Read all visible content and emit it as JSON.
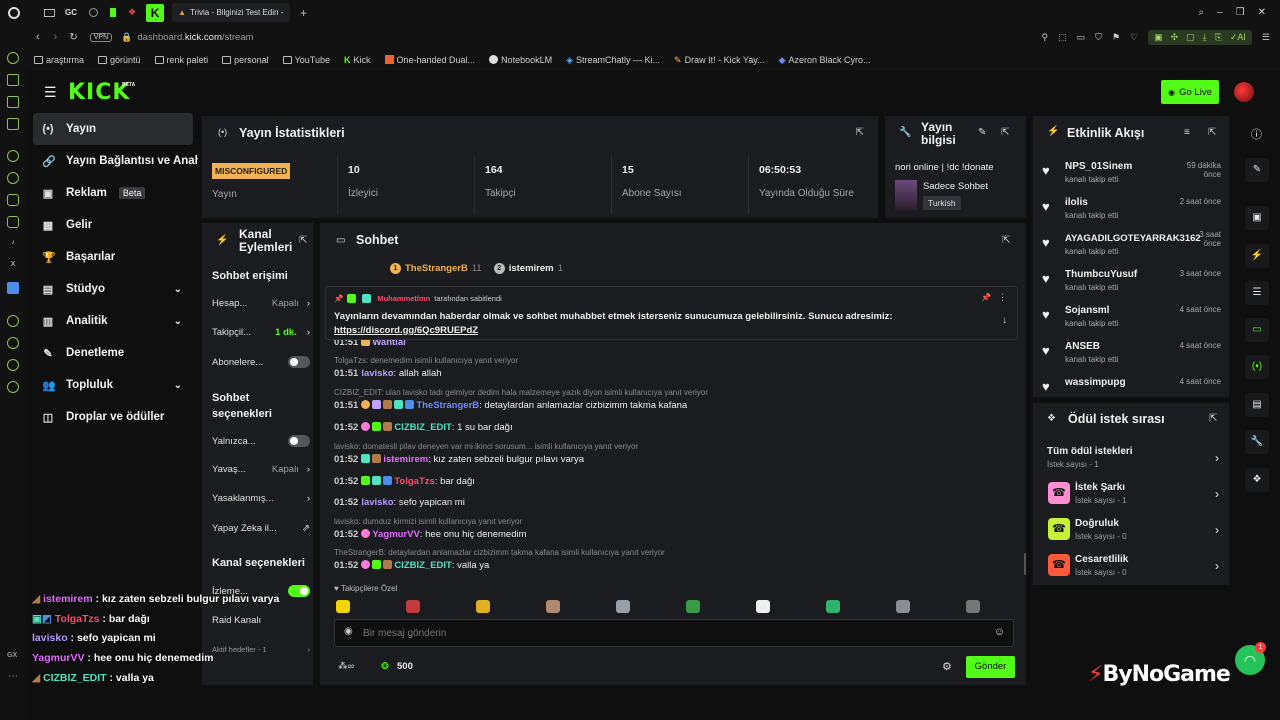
{
  "browser": {
    "tab_labels": [
      "GC"
    ],
    "active_tab_title": "Trivia - Bilginizi Test Edin -",
    "new_tab_symbol": "+",
    "url_prefix": "dashboard.",
    "url_domain": "kick.com",
    "url_path": "/stream",
    "vpn_label": "VPN",
    "ai_label": "AI",
    "bookmarks": [
      "araştırma",
      "görüntü",
      "renk paleti",
      "personal",
      "YouTube",
      "Kick",
      "One-handed Dual...",
      "NotebookLM",
      "StreamChatly — Ki...",
      "Draw It! - Kick Yay...",
      "Azeron Black Cyro..."
    ],
    "gx_label": "GX"
  },
  "header": {
    "logo": "KICK",
    "logo_beta": "BETA",
    "go_live": "Go Live"
  },
  "sidebar": {
    "items": [
      {
        "label": "Yayın",
        "icon": "(•)"
      },
      {
        "label": "Yayın Bağlantısı ve Anahtar",
        "icon": "🔗"
      },
      {
        "label": "Reklam",
        "icon": "▣",
        "badge": "Beta"
      },
      {
        "label": "Gelir",
        "icon": "▦"
      },
      {
        "label": "Başarılar",
        "icon": "🏆"
      },
      {
        "label": "Stüdyo",
        "icon": "▤"
      },
      {
        "label": "Analitik",
        "icon": "▥"
      },
      {
        "label": "Denetleme",
        "icon": "✎"
      },
      {
        "label": "Topluluk",
        "icon": "👥"
      },
      {
        "label": "Droplar ve ödüller",
        "icon": "◫"
      }
    ]
  },
  "stats": {
    "title": "Yayın İstatistikleri",
    "items": [
      {
        "value": "MISCONFIGURED",
        "label": "Yayın"
      },
      {
        "value": "10",
        "label": "İzleyici"
      },
      {
        "value": "164",
        "label": "Takipçi"
      },
      {
        "value": "15",
        "label": "Abone Sayısı"
      },
      {
        "value": "06:50:53",
        "label": "Yayında Olduğu Süre"
      }
    ]
  },
  "info": {
    "title": "Yayın bilgisi",
    "stream_title": "nori online | !dc !donate",
    "category": "Sadece Sohbet",
    "language": "Turkish"
  },
  "events": {
    "title": "Etkinlik Akışı",
    "items": [
      {
        "name": "NPS_01Sinem",
        "action": "kanalı takip etti",
        "time": "59 dakika önce"
      },
      {
        "name": "ilolis",
        "action": "kanalı takip etti",
        "time": "2 saat önce"
      },
      {
        "name": "AYAGADILGOTEYARRAK3162",
        "action": "kanalı takip etti",
        "time": "3 saat önce"
      },
      {
        "name": "ThumbcuYusuf",
        "action": "kanalı takip etti",
        "time": "3 saat önce"
      },
      {
        "name": "Sojansml",
        "action": "kanalı takip etti",
        "time": "4 saat önce"
      },
      {
        "name": "ANSEB",
        "action": "kanalı takip etti",
        "time": "4 saat önce"
      },
      {
        "name": "wassimpupg",
        "action": "",
        "time": "4 saat önce"
      }
    ]
  },
  "rewards": {
    "title": "Ödül istek sırası",
    "items": [
      {
        "title": "Tüm ödül istekleri",
        "sub": "İstek sayısı - 1"
      },
      {
        "title": "İstek Şarkı",
        "sub": "İstek sayısı - 1"
      },
      {
        "title": "Doğruluk",
        "sub": "İstek sayısı - 0"
      },
      {
        "title": "Cesaretlilik",
        "sub": "İstek sayısı - 0"
      }
    ]
  },
  "actions": {
    "title_l1": "Kanal",
    "title_l2": "Eylemleri",
    "chat_access": "Sohbet erişimi",
    "account_age": "Hesap...",
    "account_age_val": "Kapalı",
    "followers": "Takipçil...",
    "followers_val": "1 dk.",
    "subscribers": "Abonelere...",
    "chat_options_l1": "Sohbet",
    "chat_options_l2": "seçenekleri",
    "only": "Yalnızca...",
    "slow": "Yavaş...",
    "slow_val": "Kapalı",
    "banned": "Yasaklanmış...",
    "ai": "Yapay Zeka il...",
    "channel_options": "Kanal seçenekleri",
    "watch": "İzleme...",
    "raid": "Raid Kanalı",
    "goals": "Aktif hedefler - 1"
  },
  "chat": {
    "title": "Sohbet",
    "top_gifters": [
      {
        "rank": "1",
        "name": "TheStrangerB",
        "count": "11"
      },
      {
        "rank": "2",
        "name": "istemirem",
        "count": "1"
      }
    ],
    "pinned_by_user": "Muhammetlmn",
    "pinned_by_text": "tarafından sabitlendi",
    "pinned_msg_1": "Yayınların devamından haberdar olmak ve sohbet muhabbet etmek isterseniz sunucumuza gelebilirsiniz. Sunucu adresimiz:",
    "pinned_msg_2": "https://discord.gg/6Qc9RUEPdZ",
    "partial": {
      "time": "01:51",
      "user": "Wantiai"
    },
    "messages": [
      {
        "reply": "TolgaTzs: denemedim isimli kullanıcıya yanıt veriyor",
        "time": "01:51",
        "user": "lavisko",
        "user_color": "#b59cff",
        "text": "allah allah"
      },
      {
        "reply": "CIZBIZ_EDIT: ulan lavisko tadı gelmiyor dedim hala malzemeye yazık diyon isimli kullanıcıya yanıt veriyor",
        "time": "01:51",
        "user": "TheStrangerB",
        "user_color": "#6f8cff",
        "text": "detaylardan anlamazlar cizbizimm takma kafana"
      },
      {
        "reply": "",
        "time": "01:52",
        "user": "CIZBIZ_EDIT",
        "user_color": "#4fe3c2",
        "text": "1 su bar dağı"
      },
      {
        "reply": "lavisko: domatesli pilav deneyen var mi ikinci sorusum... isimli kullanıcıya yanıt veriyor",
        "time": "01:52",
        "user": "istemirem",
        "user_color": "#e36cff",
        "text": "kız zaten sebzeli bulgur pılavı varya"
      },
      {
        "reply": "",
        "time": "01:52",
        "user": "TolgaTzs",
        "user_color": "#ff4d6d",
        "text": "bar dağı"
      },
      {
        "reply": "",
        "time": "01:52",
        "user": "lavisko",
        "user_color": "#b59cff",
        "text": "sefo yapican mi"
      },
      {
        "reply": "lavisko: dumduz kirmizi isimli kullanıcıya yanıt veriyor",
        "time": "01:52",
        "user": "YagmurVV",
        "user_color": "#e36cff",
        "text": "hee onu hiç denemedim"
      },
      {
        "reply": "TheStrangerB: detaylardan anlamazlar cizbizimm takma kafana isimli kullanıcıya yanıt veriyor",
        "time": "01:52",
        "user": "CIZBIZ_EDIT",
        "user_color": "#4fe3c2",
        "text": "valla ya"
      }
    ],
    "followers_only": "Takipçilere Özel",
    "input_placeholder": "Bir mesaj gönderin",
    "points": "500",
    "send": "Gönder"
  },
  "overlay": {
    "lines": [
      {
        "user": "istemirem",
        "color": "#e36cff",
        "text": ": kız zaten sebzeli bulgur pılavı varya"
      },
      {
        "user": "TolgaTzs",
        "color": "#ff4d6d",
        "text": ": bar dağı"
      },
      {
        "user": "lavisko",
        "color": "#b59cff",
        "text": ": sefo yapican mi"
      },
      {
        "user": "YagmurVV",
        "color": "#e36cff",
        "text": ": hee onu hiç denemedim"
      },
      {
        "user": "CIZBIZ_EDIT",
        "color": "#4fe3c2",
        "text": ": valla ya"
      }
    ]
  },
  "watermark": "ByNoGame",
  "support_badge": "1",
  "colors": {
    "accent": "#53fc18",
    "panel": "#1b1c1f",
    "bg": "#0f0f10"
  }
}
